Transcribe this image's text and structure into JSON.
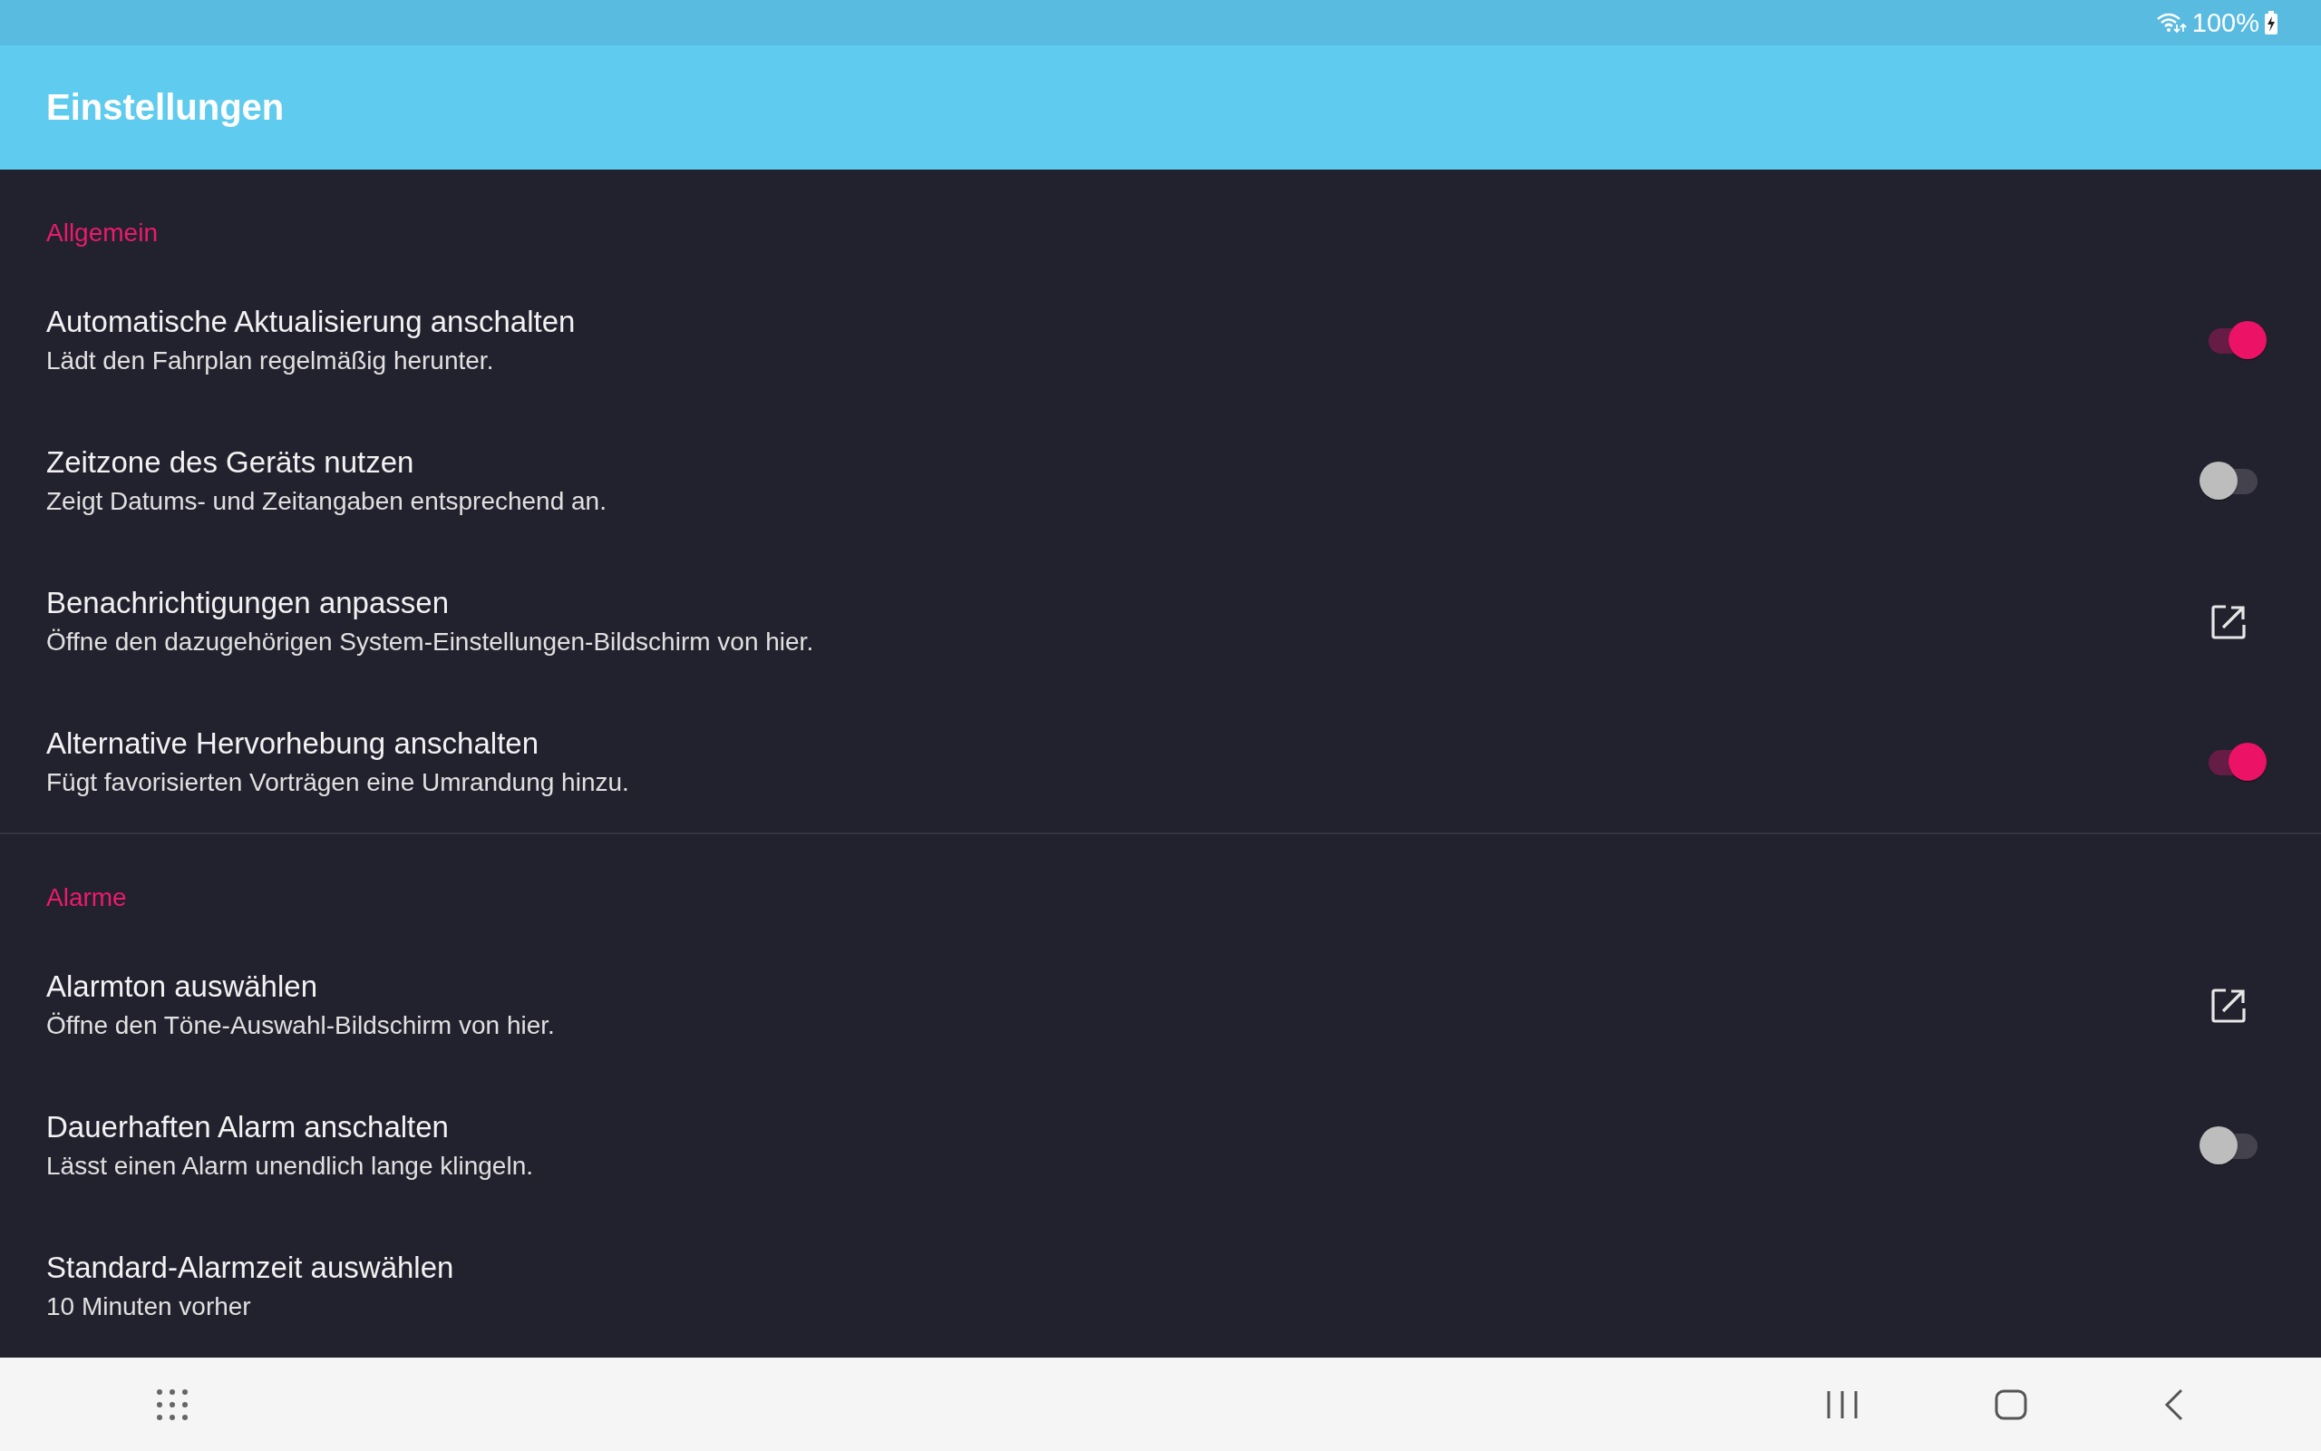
{
  "status_bar": {
    "battery": "100%"
  },
  "app_bar": {
    "title": "Einstellungen"
  },
  "sections": [
    {
      "title": "Allgemein",
      "items": [
        {
          "kind": "switch",
          "title": "Automatische Aktualisierung anschalten",
          "subtitle": "Lädt den Fahrplan regelmäßig herunter.",
          "on": true
        },
        {
          "kind": "switch",
          "title": "Zeitzone des Geräts nutzen",
          "subtitle": "Zeigt Datums- und Zeitangaben entsprechend an.",
          "on": false
        },
        {
          "kind": "link",
          "title": "Benachrichtigungen anpassen",
          "subtitle": "Öffne den dazugehörigen System-Einstellungen-Bildschirm von hier."
        },
        {
          "kind": "switch",
          "title": "Alternative Hervorhebung anschalten",
          "subtitle": "Fügt favorisierten Vorträgen eine Umrandung hinzu.",
          "on": true
        }
      ]
    },
    {
      "title": "Alarme",
      "items": [
        {
          "kind": "link",
          "title": "Alarmton auswählen",
          "subtitle": "Öffne den Töne-Auswahl-Bildschirm von hier."
        },
        {
          "kind": "switch",
          "title": "Dauerhaften Alarm anschalten",
          "subtitle": "Lässt einen Alarm unendlich lange klingeln.",
          "on": false
        },
        {
          "kind": "plain",
          "title": "Standard-Alarmzeit auswählen",
          "subtitle": "10 Minuten vorher"
        }
      ]
    }
  ]
}
